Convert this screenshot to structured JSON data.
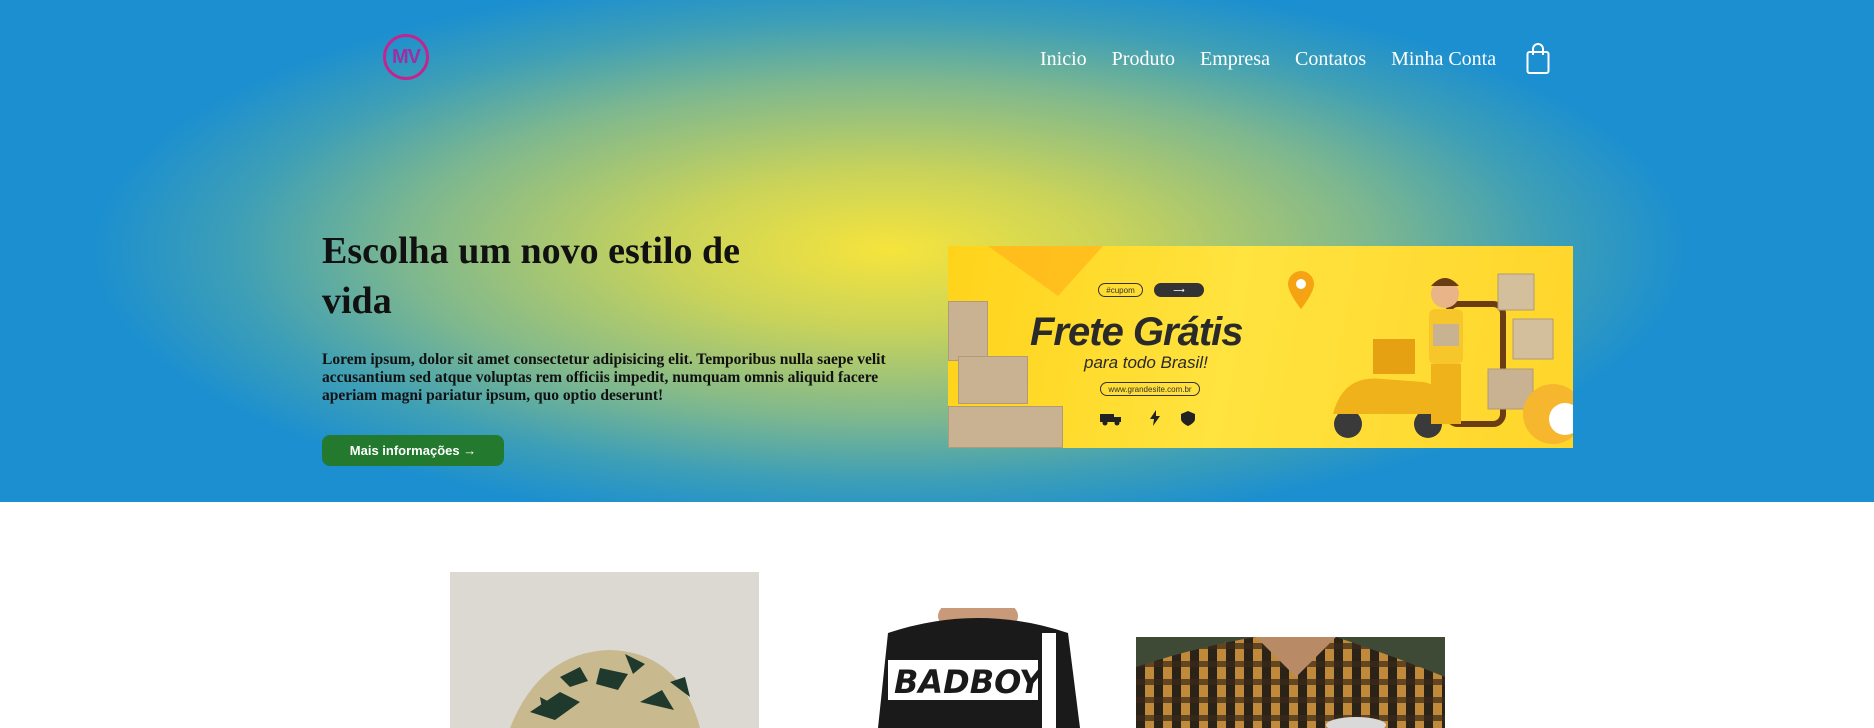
{
  "header": {
    "logo_text": "MV",
    "nav": [
      {
        "label": "Inicio"
      },
      {
        "label": "Produto"
      },
      {
        "label": "Empresa"
      },
      {
        "label": "Contatos"
      },
      {
        "label": "Minha Conta"
      }
    ],
    "cart_icon": "shopping-bag-icon"
  },
  "hero": {
    "title": "Escolha um novo estilo de vida",
    "text": "Lorem ipsum, dolor sit amet consectetur adipisicing elit. Temporibus nulla saepe velit accusantium sed atque voluptas rem officiis impedit, numquam omnis aliquid facere aperiam magni pariatur ipsum, quo optio deserunt!",
    "button_label": "Mais informações →"
  },
  "banner": {
    "title": "Frete Grátis",
    "subtitle": "para todo Brasil!",
    "coupon_label": "#cupom",
    "site": "www.grandesite.com.br"
  },
  "colors": {
    "accent_green": "#237a2f",
    "logo_magenta": "#c2258f",
    "banner_yellow": "#ffd31a"
  }
}
